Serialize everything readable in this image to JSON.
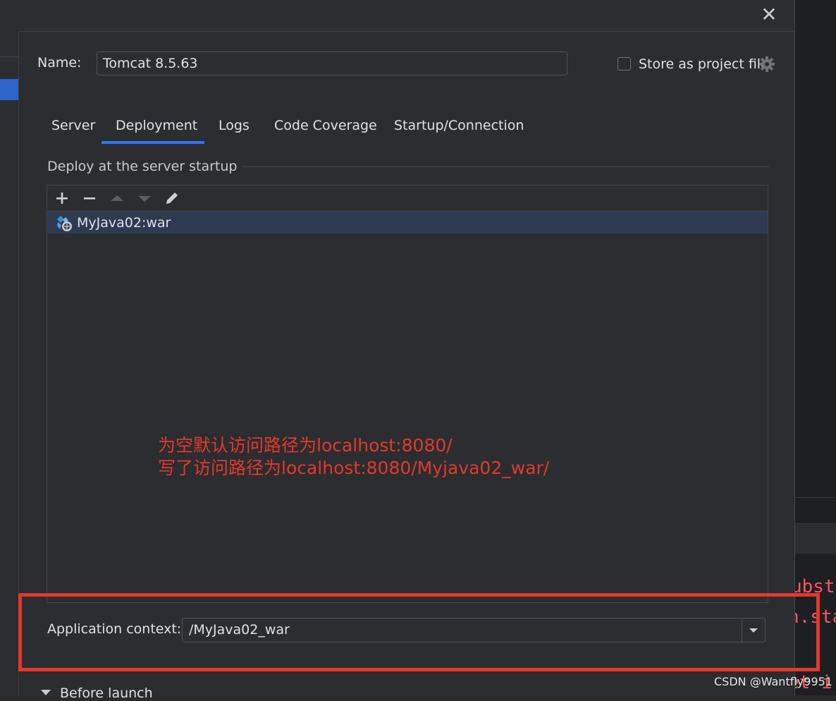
{
  "dialog": {
    "close_glyph": "✕"
  },
  "name_row": {
    "label": "Name:",
    "value": "Tomcat 8.5.63",
    "store_checkbox_checked": false,
    "store_label": "Store as project file"
  },
  "tabs": [
    {
      "label": "Server",
      "active": false
    },
    {
      "label": "Deployment",
      "active": true
    },
    {
      "label": "Logs",
      "active": false
    },
    {
      "label": "Code Coverage",
      "active": false
    },
    {
      "label": "Startup/Connection",
      "active": false
    }
  ],
  "deploy_section": {
    "title": "Deploy at the server startup",
    "toolbar_icons": [
      "add-icon",
      "remove-icon",
      "move-up-icon",
      "move-down-icon",
      "edit-icon"
    ],
    "artifacts": [
      {
        "label": "MyJava02:war",
        "selected": true,
        "icon": "artifact-war-icon"
      }
    ]
  },
  "annotation": {
    "line1": "为空默认访问路径为localhost:8080/",
    "line2": "写了访问路径为localhost:8080/Myjava02_war/",
    "color": "#e3382c"
  },
  "app_context": {
    "label": "Application context:",
    "value": "/MyJava02_war"
  },
  "before_launch": {
    "label": "Before launch"
  },
  "editor_fragments": {
    "line1": "ubstri",
    "line2": "n.sta",
    "line3": "et i"
  },
  "watermark": "CSDN @Wantfly9951",
  "colors": {
    "accent": "#3574f0",
    "selection": "#2e3a52",
    "highlight_frame": "#e3382c",
    "background": "#2b2d30"
  }
}
